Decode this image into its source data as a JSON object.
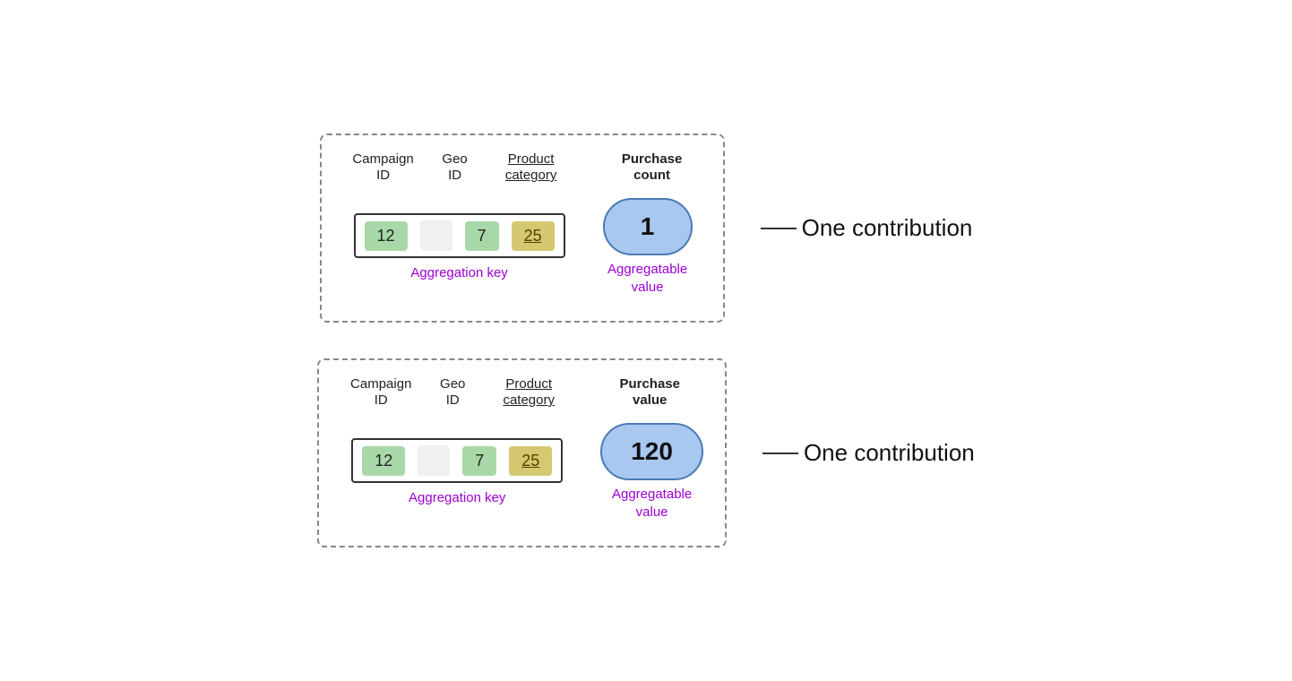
{
  "diagram": {
    "blocks": [
      {
        "id": "block1",
        "columns": {
          "campaign": {
            "header_line1": "Campaign",
            "header_line2": "ID"
          },
          "geo": {
            "header_line1": "Geo",
            "header_line2": "ID"
          },
          "product": {
            "header_line1": "Product",
            "header_line2": "category",
            "underlined": true
          },
          "purchase": {
            "header_line1": "Purchase",
            "header_line2": "count",
            "bold": true
          }
        },
        "key": {
          "campaign_val": "12",
          "geo_val": "7",
          "product_val": "25",
          "agg_key_label": "Aggregation key"
        },
        "value": {
          "val": "1",
          "label_line1": "Aggregatable",
          "label_line2": "value"
        },
        "contribution_label": "One contribution"
      },
      {
        "id": "block2",
        "columns": {
          "campaign": {
            "header_line1": "Campaign",
            "header_line2": "ID"
          },
          "geo": {
            "header_line1": "Geo",
            "header_line2": "ID"
          },
          "product": {
            "header_line1": "Product",
            "header_line2": "category",
            "underlined": true
          },
          "purchase": {
            "header_line1": "Purchase",
            "header_line2": "value",
            "bold": true
          }
        },
        "key": {
          "campaign_val": "12",
          "geo_val": "7",
          "product_val": "25",
          "agg_key_label": "Aggregation key"
        },
        "value": {
          "val": "120",
          "label_line1": "Aggregatable",
          "label_line2": "value"
        },
        "contribution_label": "One contribution"
      }
    ]
  }
}
